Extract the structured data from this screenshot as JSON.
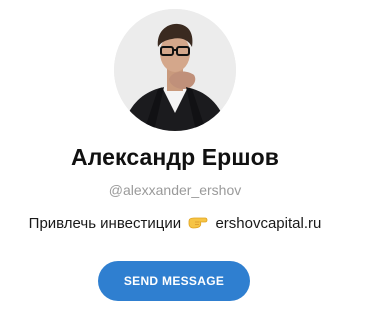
{
  "profile": {
    "name": "Александр Ершов",
    "username": "@alexxander_ershov",
    "bio_text": "Привлечь инвестиции",
    "bio_link": "ershovcapital.ru",
    "bio_emoji": "pointing-hand-emoji"
  },
  "actions": {
    "send_message_label": "SEND MESSAGE"
  },
  "colors": {
    "button_bg": "#2f7fd0",
    "username_text": "#9a9a9a"
  }
}
